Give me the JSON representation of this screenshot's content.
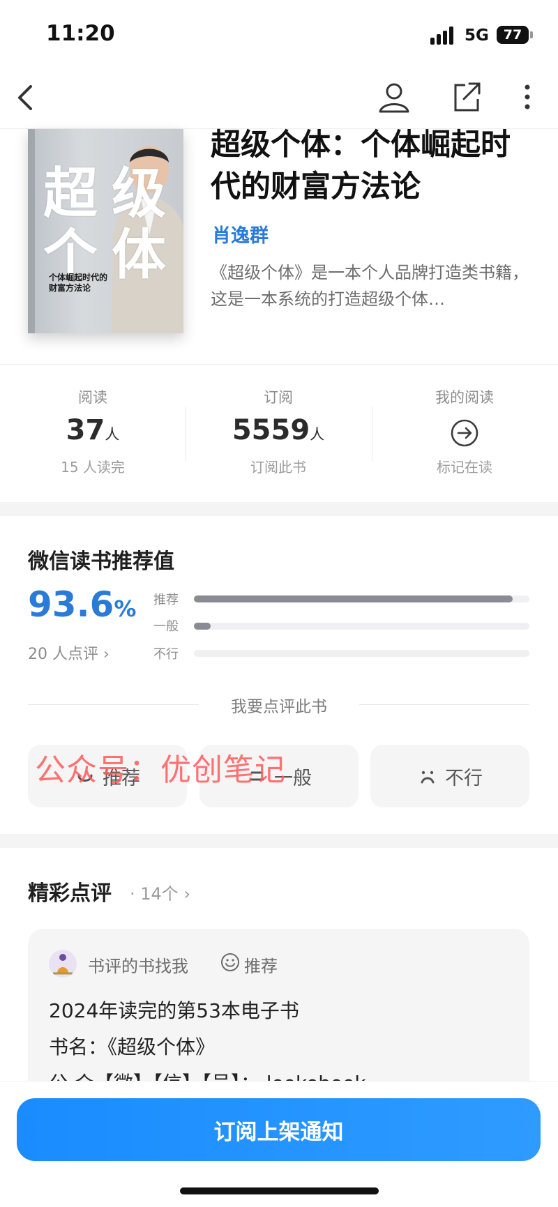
{
  "status_bar": {
    "time": "11:20",
    "network": "5G",
    "battery": "77"
  },
  "nav": {
    "back_icon": "chevron-left-icon",
    "user_icon": "user-icon",
    "share_icon": "share-external-icon",
    "more_icon": "more-vertical-icon"
  },
  "book": {
    "cover": {
      "big_chars": [
        "超",
        "级",
        "个",
        "体"
      ],
      "subtitle_line1": "个体崛起时代的",
      "subtitle_line2": "财富方法论"
    },
    "title": "超级个体：个体崛起时代的财富方法论",
    "author": "肖逸群",
    "intro": "《超级个体》是一本个人品牌打造类书籍，这是一本系统的打造超级个体…"
  },
  "stats": {
    "read": {
      "label": "阅读",
      "value": "37",
      "unit": "人",
      "sub": "15 人读完"
    },
    "subscribe": {
      "label": "订阅",
      "value": "5559",
      "unit": "人",
      "sub": "订阅此书"
    },
    "my_reading": {
      "label": "我的阅读",
      "icon": "arrow-right-circle-icon",
      "sub": "标记在读"
    }
  },
  "recommendation": {
    "title": "微信读书推荐值",
    "percent": "93.6",
    "percent_symbol": "%",
    "review_count": "20 人点评",
    "bars": [
      {
        "label": "推荐",
        "fraction": 0.95
      },
      {
        "label": "一般",
        "fraction": 0.05
      },
      {
        "label": "不行",
        "fraction": 0.0
      }
    ],
    "prompt": "我要点评此书",
    "buttons": [
      {
        "label": "推荐",
        "icon": "smile-icon"
      },
      {
        "label": "一般",
        "icon": "neutral-face-icon"
      },
      {
        "label": "不行",
        "icon": "sad-face-icon"
      }
    ],
    "watermark": "公众号：优创笔记"
  },
  "featured": {
    "title": "精彩点评",
    "count": "· 14个",
    "review": {
      "reviewer": "书评的书找我",
      "tag": "推荐",
      "lines": [
        "2024年读完的第53本电子书",
        "书名：《超级个体》",
        "公 众【微】【信】【号】：  lookebook"
      ]
    }
  },
  "cta": {
    "label": "订阅上架通知"
  },
  "colors": {
    "accent": "#2a7ad8",
    "button": "#1a8cff",
    "bar": "#8a8c94"
  }
}
